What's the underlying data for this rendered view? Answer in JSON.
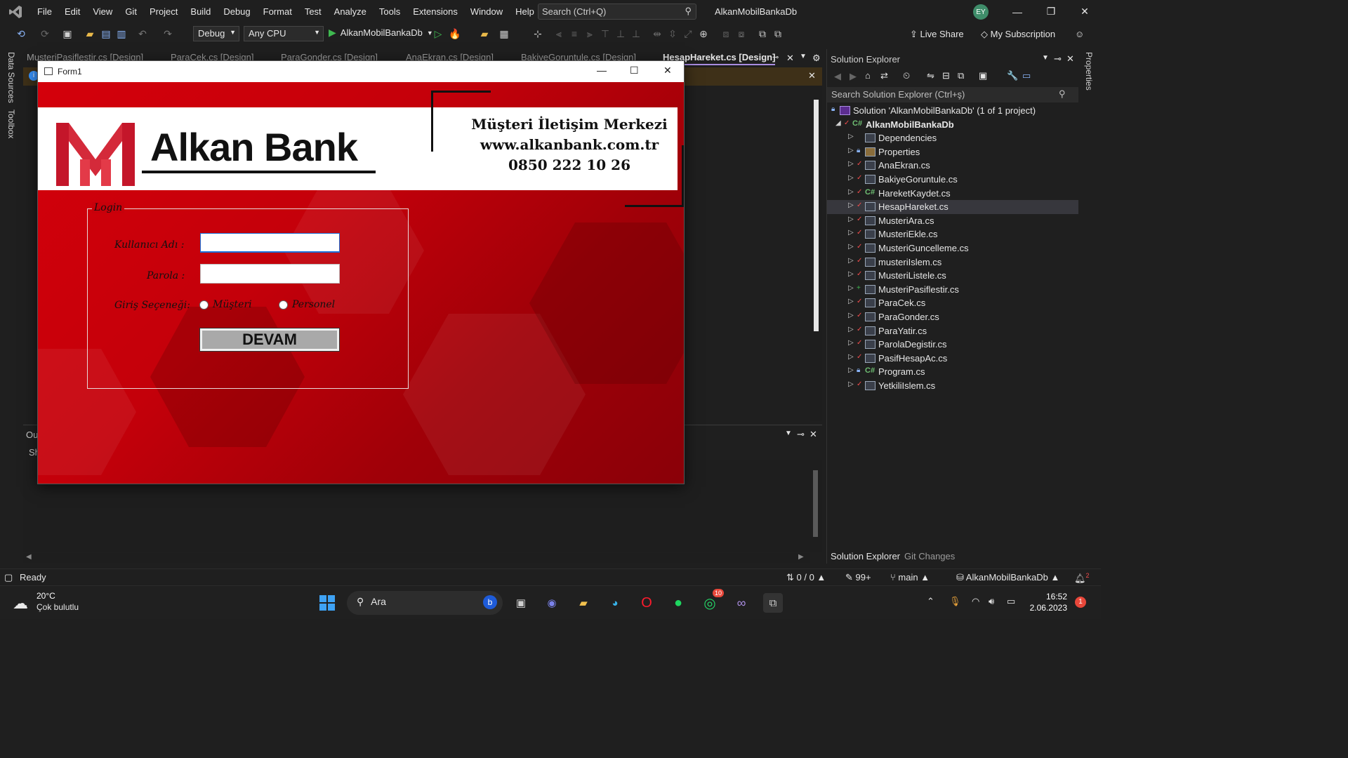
{
  "ide": {
    "menu": [
      "File",
      "Edit",
      "View",
      "Git",
      "Project",
      "Build",
      "Debug",
      "Format",
      "Test",
      "Analyze",
      "Tools",
      "Extensions",
      "Window",
      "Help"
    ],
    "search_placeholder": "Search (Ctrl+Q)",
    "solution_name": "AlkanMobilBankaDb",
    "avatar": "EY",
    "toolbar": {
      "config": "Debug",
      "platform": "Any CPU",
      "run_target": "AlkanMobilBankaDb",
      "live_share": "Live Share",
      "subscription": "My Subscription"
    },
    "left_tabs": [
      "Data Sources",
      "Toolbox"
    ],
    "right_tabs": [
      "Properties"
    ],
    "doc_tabs": [
      "MusteriPasiflestir.cs [Design]",
      "ParaCek.cs [Design]",
      "ParaGonder.cs [Design]",
      "AnaEkran.cs [Design]",
      "BakiyeGoruntule.cs [Design]",
      "HesapHareket.cs [Design]"
    ],
    "output": {
      "title": "Ou",
      "show": "Sh"
    }
  },
  "solution_explorer": {
    "title": "Solution Explorer",
    "search_placeholder": "Search Solution Explorer (Ctrl+ş)",
    "solution": "Solution 'AlkanMobilBankaDb' (1 of 1 project)",
    "project": "AlkanMobilBankaDb",
    "items": [
      {
        "label": "Dependencies",
        "kind": "deps",
        "state": ""
      },
      {
        "label": "Properties",
        "kind": "props",
        "state": "lock"
      },
      {
        "label": "AnaEkran.cs",
        "kind": "form",
        "state": "check"
      },
      {
        "label": "BakiyeGoruntule.cs",
        "kind": "form",
        "state": "check"
      },
      {
        "label": "HareketKaydet.cs",
        "kind": "cs",
        "state": "check"
      },
      {
        "label": "HesapHareket.cs",
        "kind": "form",
        "state": "check"
      },
      {
        "label": "MusteriAra.cs",
        "kind": "form",
        "state": "check"
      },
      {
        "label": "MusteriEkle.cs",
        "kind": "form",
        "state": "check"
      },
      {
        "label": "MusteriGuncelleme.cs",
        "kind": "form",
        "state": "check"
      },
      {
        "label": "musteriIslem.cs",
        "kind": "form",
        "state": "check"
      },
      {
        "label": "MusteriListele.cs",
        "kind": "form",
        "state": "check"
      },
      {
        "label": "MusteriPasiflestir.cs",
        "kind": "form",
        "state": "plus"
      },
      {
        "label": "ParaCek.cs",
        "kind": "form",
        "state": "check"
      },
      {
        "label": "ParaGonder.cs",
        "kind": "form",
        "state": "check"
      },
      {
        "label": "ParaYatir.cs",
        "kind": "form",
        "state": "check"
      },
      {
        "label": "ParolaDegistir.cs",
        "kind": "form",
        "state": "check"
      },
      {
        "label": "PasifHesapAc.cs",
        "kind": "form",
        "state": "check"
      },
      {
        "label": "Program.cs",
        "kind": "cs",
        "state": "lock"
      },
      {
        "label": "YetkiliIslem.cs",
        "kind": "form",
        "state": "check"
      }
    ],
    "selected_index": 5,
    "bottom_tabs": [
      "Solution Explorer",
      "Git Changes"
    ]
  },
  "status": {
    "ready": "Ready",
    "lines": "0 / 0",
    "edits": "99+",
    "branch": "main",
    "repo": "AlkanMobilBankaDb",
    "notifications": "2"
  },
  "form": {
    "window_title": "Form1",
    "bank_name": "Alkan Bank",
    "contact_line1": "Müşteri İletişim Merkezi",
    "contact_line2": "www.alkanbank.com.tr",
    "contact_line3": "0850 222 10 26",
    "group_title": "Login",
    "username_label": "Kullanıcı Adı :",
    "password_label": "Parola :",
    "login_option_label": "Giriş Seçeneği:",
    "radio_customer": "Müşteri",
    "radio_staff": "Personel",
    "submit": "DEVAM",
    "username_value": "",
    "password_value": ""
  },
  "taskbar": {
    "weather_temp": "20°C",
    "weather_desc": "Çok bulutlu",
    "search": "Ara",
    "whatsapp_badge": "10",
    "time": "16:52",
    "date": "2.06.2023",
    "notif_badge": "1"
  },
  "colors": {
    "accent": "#c8000a",
    "vs_purple": "#a98ce0"
  }
}
